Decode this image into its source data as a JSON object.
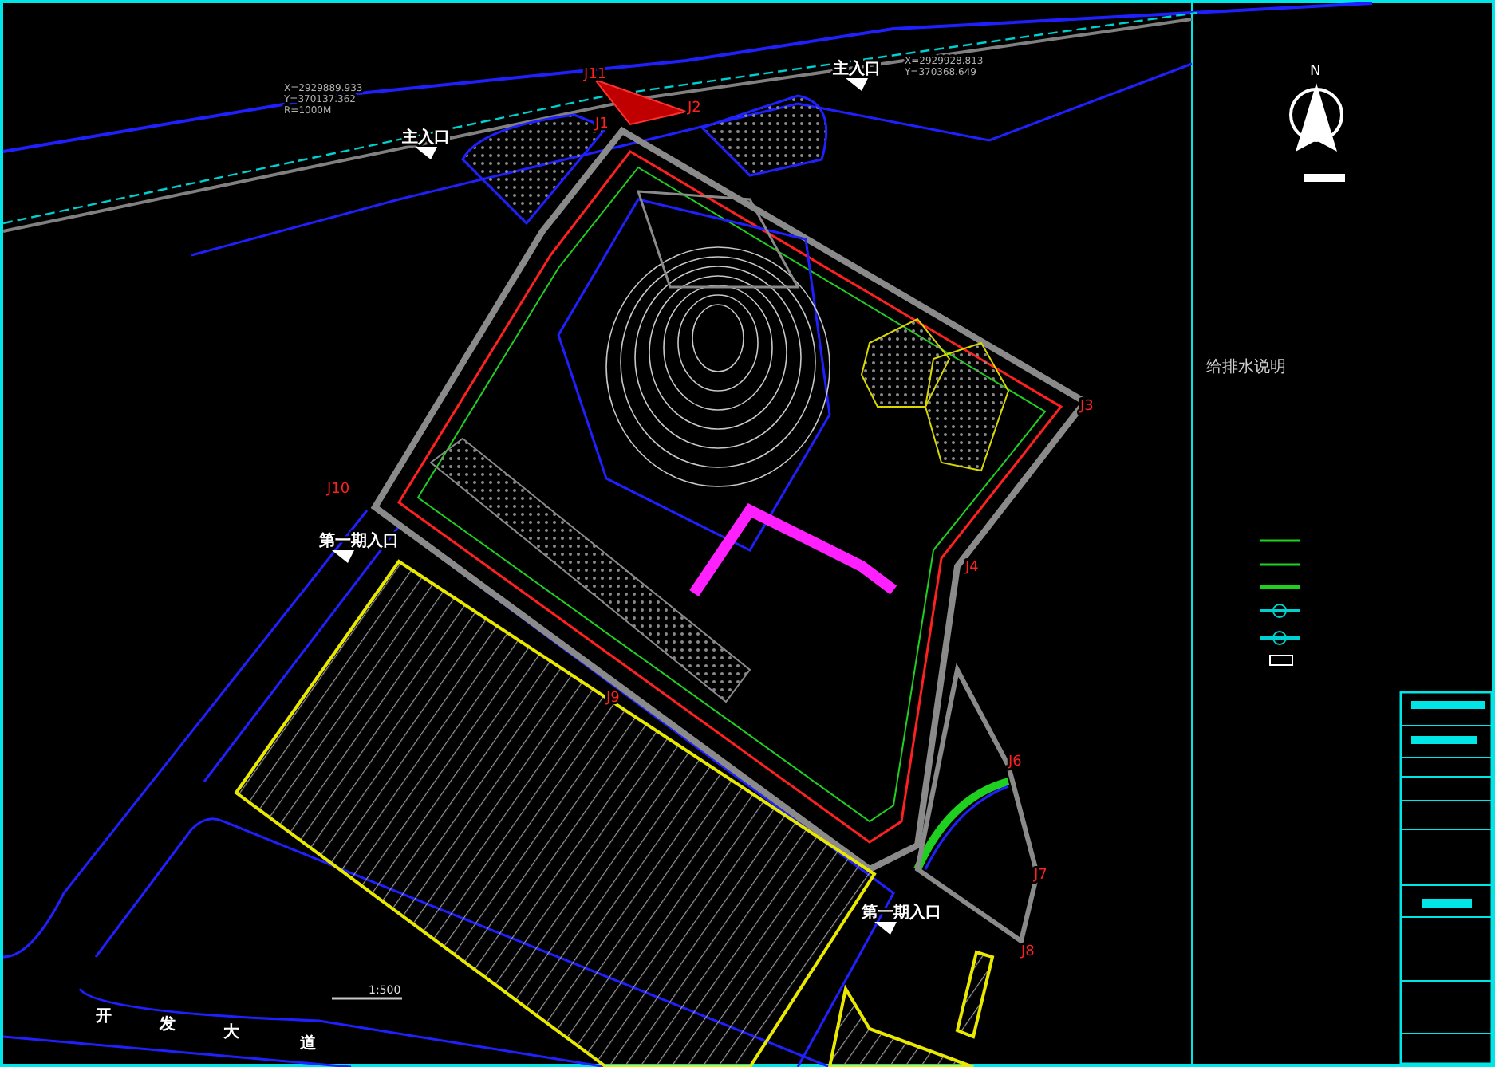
{
  "drawing": {
    "points": [
      "J11",
      "J1",
      "J2",
      "J3",
      "J4",
      "J6",
      "J7",
      "J8",
      "J9",
      "J10"
    ],
    "coordinates": [
      {
        "lines": [
          "X=2929889.933",
          "Y=370137.362",
          "R=1000M"
        ]
      },
      {
        "lines": [
          "X=2929928.813",
          "Y=370368.649"
        ]
      }
    ],
    "entrances": [
      "主入口",
      "主入口",
      "第一期入口",
      "第一期入口"
    ],
    "road_name": [
      "开",
      "发",
      "大",
      "道"
    ],
    "scale": "1:500"
  },
  "side_panel": {
    "north": "N",
    "notes_title": "给排水说明"
  }
}
